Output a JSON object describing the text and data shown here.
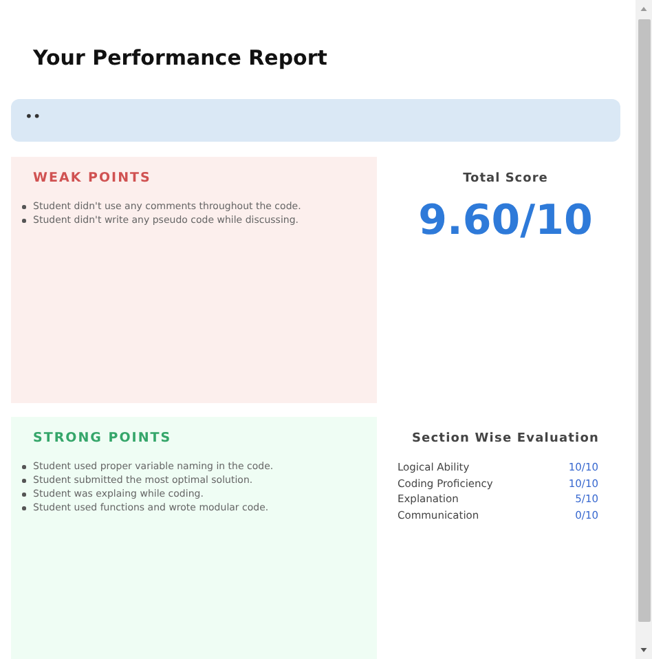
{
  "title": "Your Performance Report",
  "banner": {
    "text": "••"
  },
  "weak_points": {
    "heading": "WEAK POINTS",
    "items": [
      "Student didn't use any comments throughout the code.",
      "Student didn't write any pseudo code while discussing."
    ]
  },
  "total_score": {
    "label": "Total Score",
    "value": "9.60/10"
  },
  "strong_points": {
    "heading": "STRONG POINTS",
    "items": [
      "Student used proper variable naming in the code.",
      "Student submitted the most optimal solution.",
      "Student was explaing while coding.",
      "Student used functions and wrote modular code."
    ]
  },
  "section_evaluation": {
    "heading": "Section Wise Evaluation",
    "rows": [
      {
        "name": "Logical Ability",
        "score": "10/10"
      },
      {
        "name": "Coding Proficiency",
        "score": "10/10"
      },
      {
        "name": "Explanation",
        "score": "5/10"
      },
      {
        "name": "Communication",
        "score": "0/10"
      }
    ]
  }
}
